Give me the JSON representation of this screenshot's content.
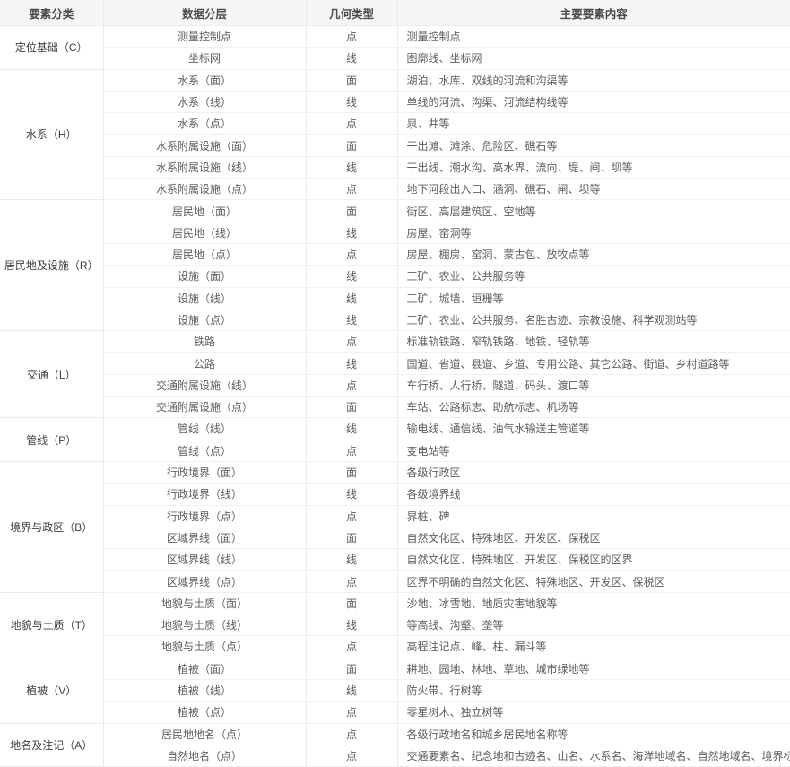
{
  "table": {
    "headers": [
      "要素分类",
      "数据分层",
      "几何类型",
      "主要要素内容"
    ],
    "groups": [
      {
        "category": "定位基础（C）",
        "rows": [
          {
            "layer": "测量控制点",
            "geometry": "点",
            "content": "测量控制点"
          },
          {
            "layer": "坐标网",
            "geometry": "线",
            "content": "图廓线、坐标网"
          }
        ]
      },
      {
        "category": "水系（H）",
        "rows": [
          {
            "layer": "水系（面）",
            "geometry": "面",
            "content": "湖泊、水库、双线的河流和沟渠等"
          },
          {
            "layer": "水系（线）",
            "geometry": "线",
            "content": "单线的河流、沟渠、河流结构线等"
          },
          {
            "layer": "水系（点）",
            "geometry": "点",
            "content": "泉、井等"
          },
          {
            "layer": "水系附属设施（面）",
            "geometry": "面",
            "content": "干出滩、滩涂、危险区、礁石等"
          },
          {
            "layer": "水系附属设施（线）",
            "geometry": "线",
            "content": "干出线、潮水沟、高水界、流向、堤、闸、坝等"
          },
          {
            "layer": "水系附属设施（点）",
            "geometry": "点",
            "content": "地下河段出入口、涵洞、礁石、闸、坝等"
          }
        ]
      },
      {
        "category": "居民地及设施（R）",
        "rows": [
          {
            "layer": "居民地（面）",
            "geometry": "面",
            "content": "街区、高层建筑区、空地等"
          },
          {
            "layer": "居民地（线）",
            "geometry": "线",
            "content": "房屋、窑洞等"
          },
          {
            "layer": "居民地（点）",
            "geometry": "点",
            "content": "房屋、棚房、窑洞、蒙古包、放牧点等"
          },
          {
            "layer": "设施（面）",
            "geometry": "线",
            "content": "工矿、农业、公共服务等"
          },
          {
            "layer": "设施（线）",
            "geometry": "线",
            "content": "工矿、城墙、垣栅等"
          },
          {
            "layer": "设施（点）",
            "geometry": "线",
            "content": "工矿、农业、公共服务、名胜古迹、宗教设施、科学观测站等"
          }
        ]
      },
      {
        "category": "交通（L）",
        "rows": [
          {
            "layer": "铁路",
            "geometry": "点",
            "content": "标准轨铁路、窄轨铁路、地铁、轻轨等"
          },
          {
            "layer": "公路",
            "geometry": "线",
            "content": "国道、省道、县道、乡道、专用公路、其它公路、街道、乡村道路等"
          },
          {
            "layer": "交通附属设施（线）",
            "geometry": "点",
            "content": "车行桥、人行桥、隧道、码头、渡口等"
          },
          {
            "layer": "交通附属设施（点）",
            "geometry": "面",
            "content": "车站、公路标志、助航标志、机场等"
          }
        ]
      },
      {
        "category": "管线（P）",
        "rows": [
          {
            "layer": "管线（线）",
            "geometry": "线",
            "content": "输电线、通信线、油气水输送主管道等"
          },
          {
            "layer": "管线（点）",
            "geometry": "点",
            "content": "变电站等"
          }
        ]
      },
      {
        "category": "境界与政区（B）",
        "rows": [
          {
            "layer": "行政境界（面）",
            "geometry": "面",
            "content": "各级行政区"
          },
          {
            "layer": "行政境界（线）",
            "geometry": "线",
            "content": "各级境界线"
          },
          {
            "layer": "行政境界（点）",
            "geometry": "点",
            "content": "界桩、碑"
          },
          {
            "layer": "区域界线（面）",
            "geometry": "面",
            "content": "自然文化区、特殊地区、开发区、保税区"
          },
          {
            "layer": "区域界线（线）",
            "geometry": "线",
            "content": "自然文化区、特殊地区、开发区、保税区的区界"
          },
          {
            "layer": "区域界线（点）",
            "geometry": "点",
            "content": "区界不明确的自然文化区、特殊地区、开发区、保税区"
          }
        ]
      },
      {
        "category": "地貌与土质（T）",
        "rows": [
          {
            "layer": "地貌与土质（面）",
            "geometry": "面",
            "content": "沙地、冰雪地、地质灾害地貌等"
          },
          {
            "layer": "地貌与土质（线）",
            "geometry": "线",
            "content": "等高线、沟壑、垄等"
          },
          {
            "layer": "地貌与土质（点）",
            "geometry": "点",
            "content": "高程注记点、峰、柱、漏斗等"
          }
        ]
      },
      {
        "category": "植被（V）",
        "rows": [
          {
            "layer": "植被（面）",
            "geometry": "面",
            "content": "耕地、园地、林地、草地、城市绿地等"
          },
          {
            "layer": "植被（线）",
            "geometry": "线",
            "content": "防火带、行树等"
          },
          {
            "layer": "植被（点）",
            "geometry": "点",
            "content": "零星树木、独立树等"
          }
        ]
      },
      {
        "category": "地名及注记（A）",
        "rows": [
          {
            "layer": "居民地地名（点）",
            "geometry": "点",
            "content": "各级行政地名和城乡居民地名称等"
          },
          {
            "layer": "自然地名（点）",
            "geometry": "点",
            "content": "交通要素名、纪念地和古迹名、山名、水系名、海洋地域名、自然地域名、境界标志名等"
          }
        ]
      }
    ]
  }
}
